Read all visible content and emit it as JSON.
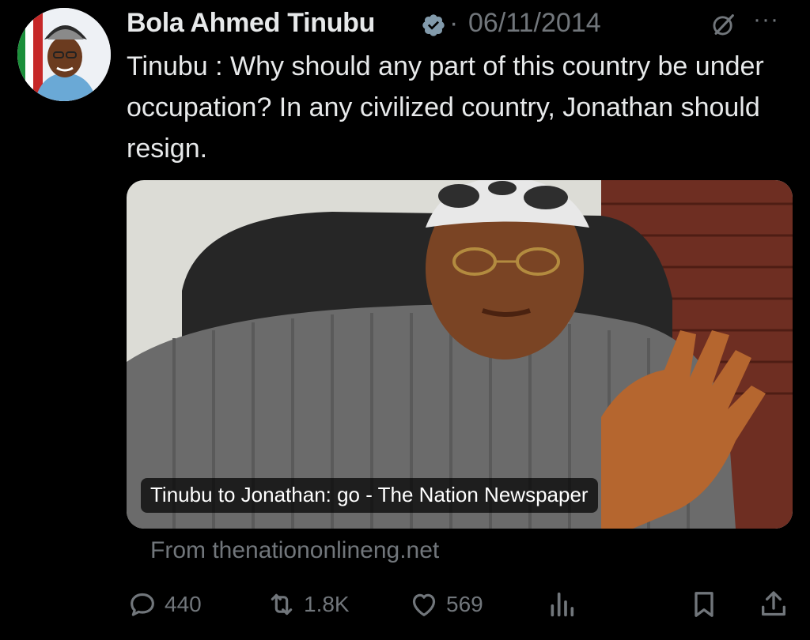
{
  "author": {
    "name": "Bola Ahmed Tinubu",
    "verified": true,
    "separator": "·",
    "date": "06/11/2014"
  },
  "tweet": {
    "text": "Tinubu :  Why should any part of this country be under occupation? In any civilized country, Jonathan should resign."
  },
  "card": {
    "title": "Tinubu to Jonathan: go - The Nation Newspaper",
    "source": "From thenationonlineng.net"
  },
  "actions": {
    "replies": "440",
    "reposts": "1.8K",
    "likes": "569"
  },
  "icons": [
    "verified-badge-icon",
    "grok-icon",
    "more-icon",
    "reply-icon",
    "repost-icon",
    "like-icon",
    "views-icon",
    "bookmark-icon",
    "share-icon"
  ],
  "colors": {
    "background": "#000000",
    "text": "#e7e9ea",
    "muted": "#71767b"
  }
}
